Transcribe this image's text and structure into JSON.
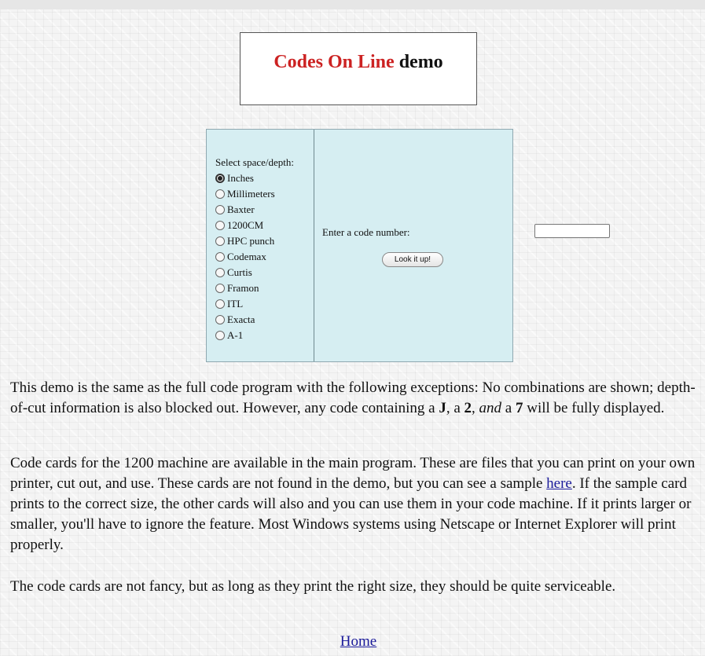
{
  "title": {
    "red": "Codes On Line",
    "black": "demo"
  },
  "form": {
    "space_depth_label": "Select space/depth:",
    "options": [
      "Inches",
      "Millimeters",
      "Baxter",
      "1200CM",
      "HPC punch",
      "Codemax",
      "Curtis",
      "Framon",
      "ITL",
      "Exacta",
      "A-1"
    ],
    "selected_option": "Inches",
    "code_label": "Enter a code number:",
    "code_value": "",
    "lookup_button": "Look it up!"
  },
  "paragraphs": {
    "p1": {
      "a": "This demo is the same as the full code program with the following exceptions:  No combinations are shown; depth-of-cut information is also blocked out.  However, any code containing a ",
      "j": "J",
      "b": ", a ",
      "two": "2",
      "c": ", ",
      "and": "and",
      "d": " a ",
      "seven": "7",
      "e": " will be fully displayed."
    },
    "p2": {
      "a": "Code cards for the 1200 machine are available in the main program.  These are files that you can print on your own printer, cut out, and use.  These cards are not found in the demo, but you can see a sample ",
      "link": "here",
      "b": ".  If the sample card prints to the correct size, the other cards will also and you can use them in your code machine.  If it prints larger or smaller, you'll have to ignore the feature.  Most Windows systems using Netscape or Internet Explorer will print properly."
    },
    "p3": "The code cards are not fancy, but as long as they print the right size, they should be quite serviceable."
  },
  "footer": {
    "home_link": "Home"
  },
  "colors": {
    "title_red": "#cc2222",
    "form_bg": "#d6eef2",
    "link": "#1a1a9a"
  }
}
